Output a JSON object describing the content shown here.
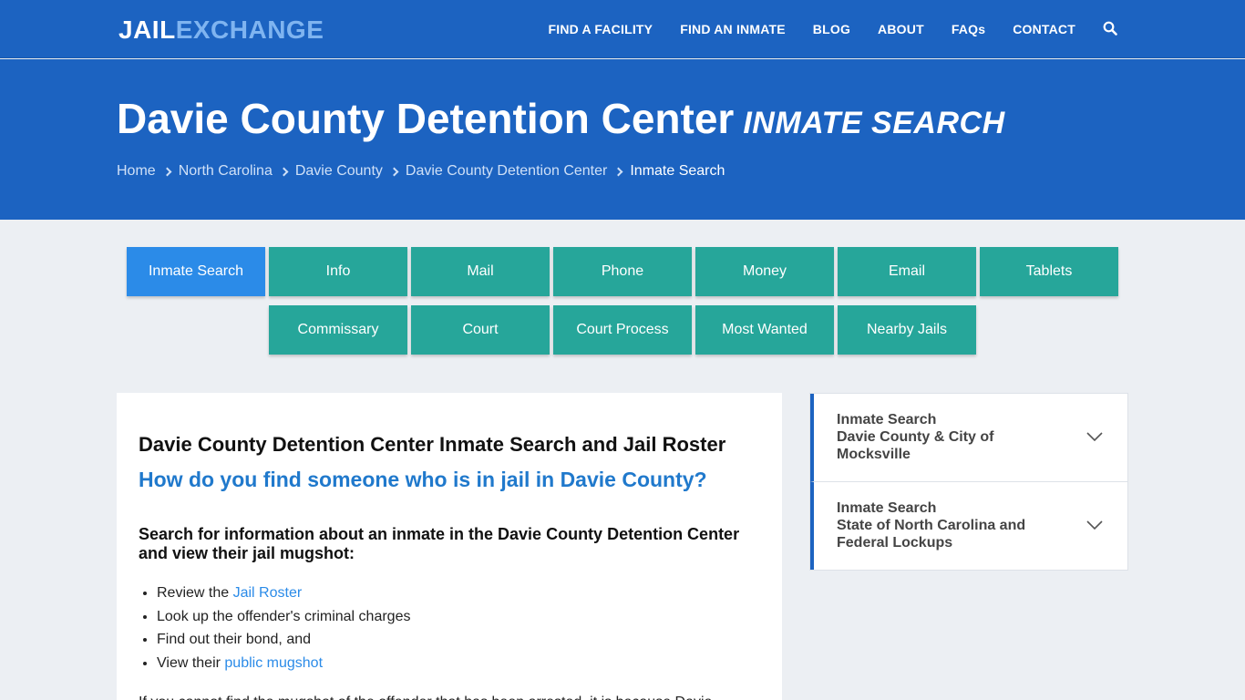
{
  "logo": {
    "part1": "JAIL",
    "part2": "EXCHANGE"
  },
  "nav": {
    "items": [
      "FIND A FACILITY",
      "FIND AN INMATE",
      "BLOG",
      "ABOUT",
      "FAQs",
      "CONTACT"
    ],
    "search_icon": "search-icon"
  },
  "hero": {
    "title": "Davie County Detention Center",
    "subtitle": "INMATE SEARCH",
    "breadcrumb": [
      "Home",
      "North Carolina",
      "Davie County",
      "Davie County Detention Center",
      "Inmate Search"
    ]
  },
  "tabs": {
    "row1": [
      "Inmate Search",
      "Info",
      "Mail",
      "Phone",
      "Money",
      "Email",
      "Tablets"
    ],
    "row2": [
      "Commissary",
      "Court",
      "Court Process",
      "Most Wanted",
      "Nearby Jails"
    ],
    "active": "Inmate Search"
  },
  "main": {
    "heading": "Davie County Detention Center Inmate Search and Jail Roster",
    "question": "How do you find someone who is in jail in Davie County?",
    "intro": "Search for information about an inmate in the Davie County Detention Center and view their jail mugshot:",
    "bullets": [
      {
        "text": "Review the ",
        "link": "Jail Roster"
      },
      {
        "text": "Look up the offender's criminal charges",
        "link": ""
      },
      {
        "text": "Find out their bond, and",
        "link": ""
      },
      {
        "text": "View their ",
        "link": "public mugshot"
      }
    ],
    "paragraph": "If you cannot find the mugshot of the offender that has been arrested, it is because Davie"
  },
  "sidebar": {
    "items": [
      {
        "title": "Inmate Search",
        "subtitle": "Davie County & City of Mocksville"
      },
      {
        "title": "Inmate Search",
        "subtitle": "State of North Carolina and Federal Lockups"
      }
    ]
  },
  "colors": {
    "header_blue": "#1c63c1",
    "logo_accent": "#7fb4f0",
    "tab_teal": "#26a69a",
    "tab_active": "#2b8be8",
    "link": "#2b8be8",
    "question_blue": "#2079cc",
    "page_bg": "#eceff3"
  }
}
